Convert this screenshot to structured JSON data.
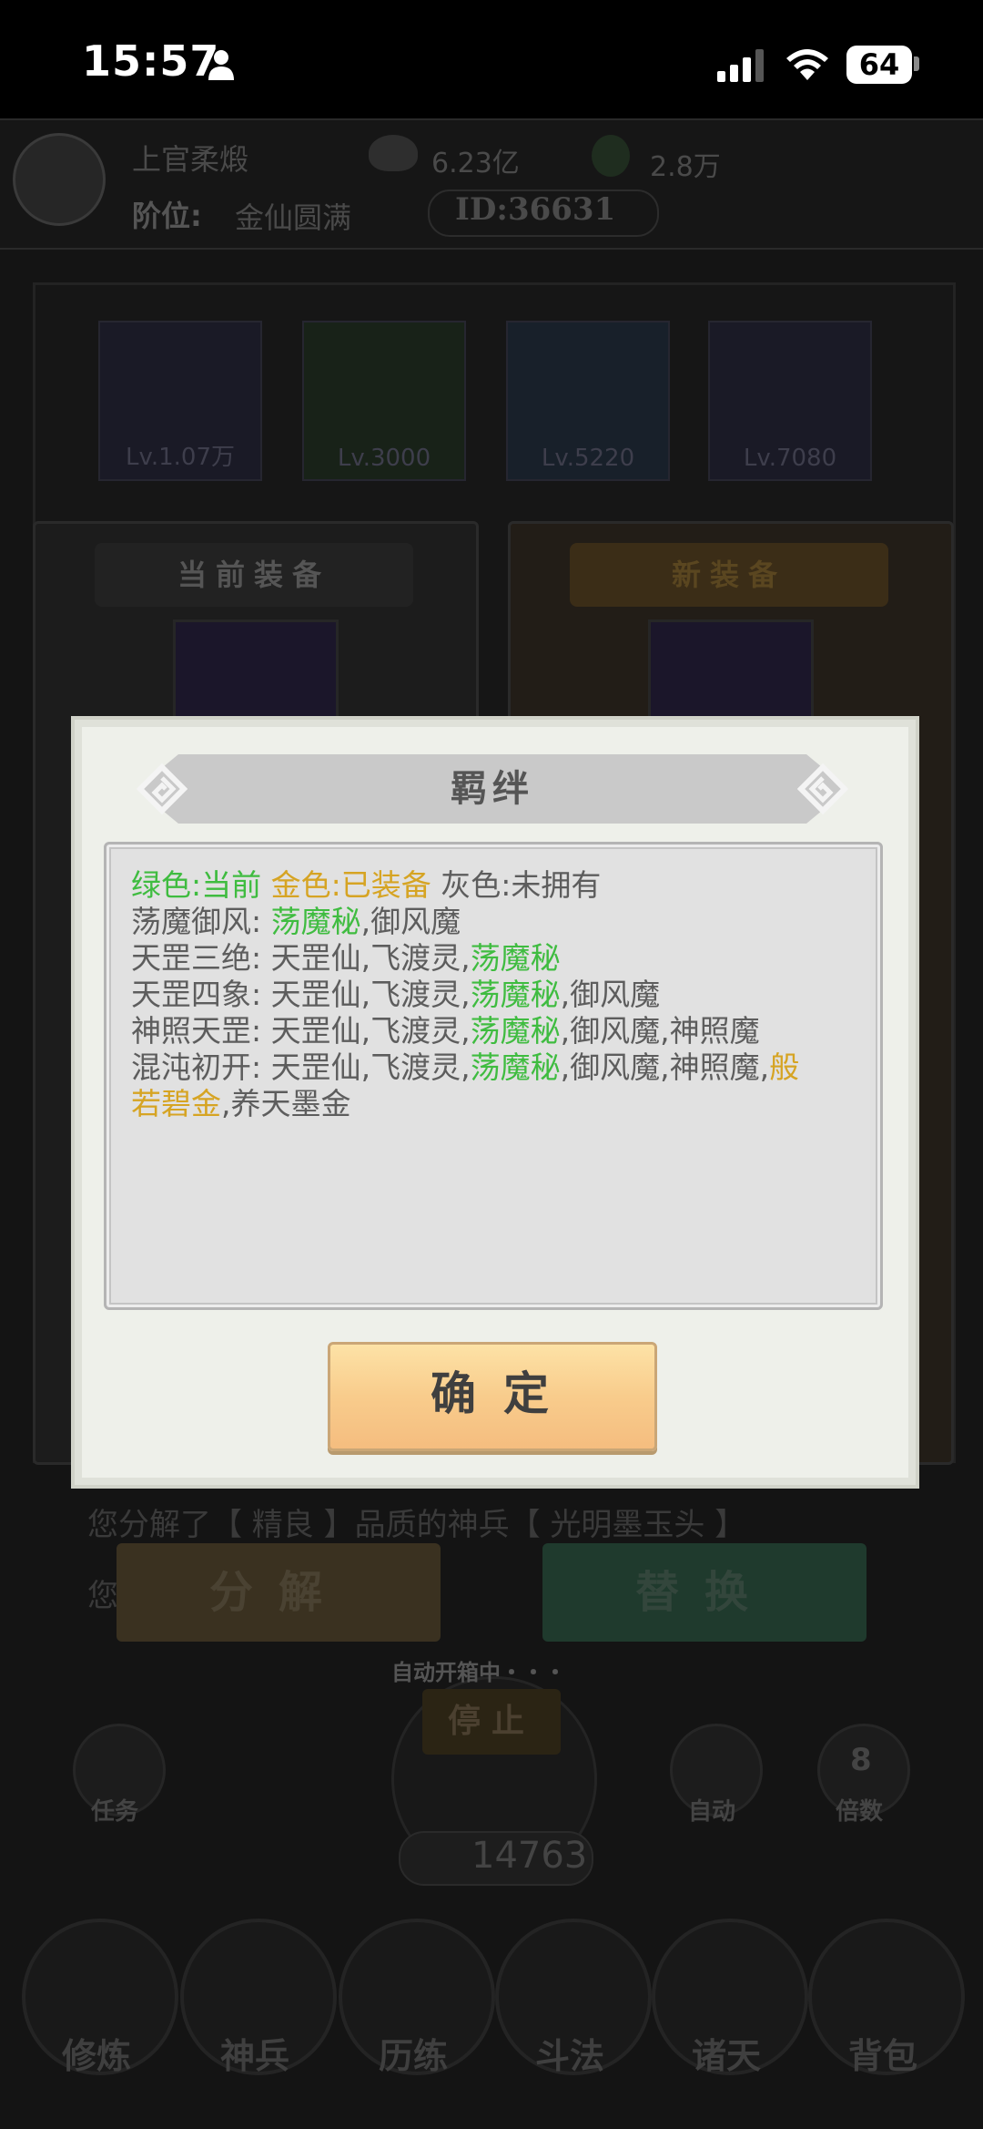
{
  "status_bar": {
    "time": "15:57",
    "battery": "64"
  },
  "header": {
    "player_name": "上官柔煅",
    "stones": "6.23亿",
    "jade": "2.8万",
    "rank_label": "阶位:",
    "rank_value": "金仙圆满",
    "id": "ID:36631"
  },
  "equipment_slots": [
    {
      "level": "Lv.1.07万"
    },
    {
      "level": "Lv.3000"
    },
    {
      "level": "Lv.5220"
    },
    {
      "level": "Lv.7080"
    }
  ],
  "compare": {
    "current_label": "当前装备",
    "new_label": "新装备"
  },
  "log": {
    "line1": "您分解了【 精良 】品质的神兵【 光明墨玉头 】",
    "line2": "您"
  },
  "actions": {
    "decompose": "分解",
    "replace": "替换",
    "auto_status": "自动开箱中・・・",
    "stop": "停止",
    "count": "14763",
    "task": "任务",
    "auto": "自动",
    "times_badge": "8",
    "times": "倍数"
  },
  "bottom_nav": [
    "修炼",
    "神兵",
    "历练",
    "斗法",
    "诸天",
    "背包"
  ],
  "modal": {
    "title": "羁绊",
    "legend": {
      "green": "绿色:当前",
      "gold": "金色:已装备",
      "gray": "灰色:未拥有"
    },
    "lines": [
      {
        "name": "荡魔御风: ",
        "parts": [
          {
            "t": "荡魔秘",
            "c": "g"
          },
          {
            "t": ",御风魔",
            "c": ""
          }
        ]
      },
      {
        "name": "天罡三绝: ",
        "parts": [
          {
            "t": "天罡仙,飞渡灵,",
            "c": ""
          },
          {
            "t": "荡魔秘",
            "c": "g"
          }
        ]
      },
      {
        "name": "天罡四象: ",
        "parts": [
          {
            "t": "天罡仙,飞渡灵,",
            "c": ""
          },
          {
            "t": "荡魔秘",
            "c": "g"
          },
          {
            "t": ",御风魔",
            "c": ""
          }
        ]
      },
      {
        "name": "神照天罡: ",
        "parts": [
          {
            "t": "天罡仙,飞渡灵,",
            "c": ""
          },
          {
            "t": "荡魔秘",
            "c": "g"
          },
          {
            "t": ",御风魔,神照魔",
            "c": ""
          }
        ]
      },
      {
        "name": "混沌初开: ",
        "parts": [
          {
            "t": "天罡仙,飞渡灵,",
            "c": ""
          },
          {
            "t": "荡魔秘",
            "c": "g"
          },
          {
            "t": ",御风魔,神照魔,",
            "c": ""
          },
          {
            "t": "般",
            "c": "y"
          }
        ]
      },
      {
        "name": "",
        "parts": [
          {
            "t": "若碧金",
            "c": "y"
          },
          {
            "t": ",养天墨金",
            "c": ""
          }
        ]
      }
    ],
    "confirm": "确定"
  },
  "colors": {
    "current_green": "#3fbc40",
    "equipped_gold": "#d6a423",
    "unowned_gray": "#5d5d5d",
    "confirm_button": "#f8cc8c"
  }
}
